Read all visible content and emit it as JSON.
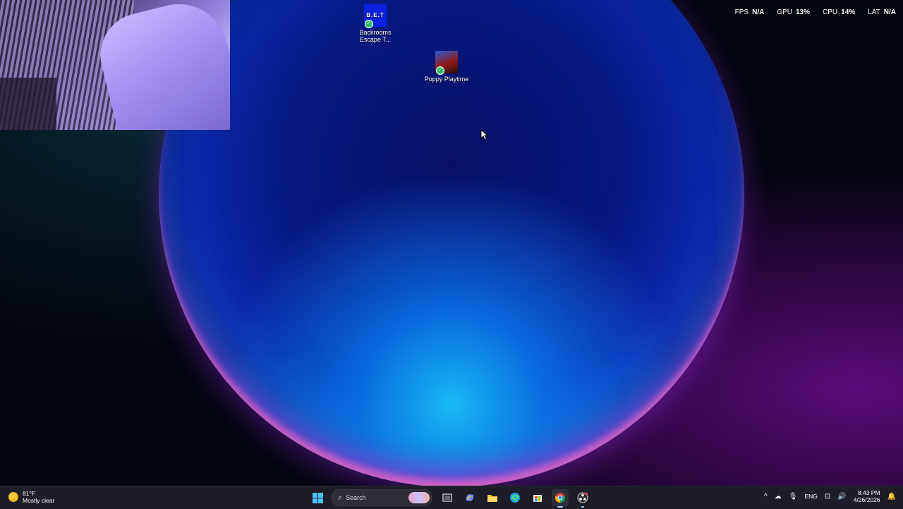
{
  "overlay": {
    "fps_label": "FPS",
    "fps_value": "N/A",
    "gpu_label": "GPU",
    "gpu_value": "13%",
    "cpu_label": "CPU",
    "cpu_value": "14%",
    "lat_label": "LAT",
    "lat_value": "N/A"
  },
  "desktop_icons": [
    {
      "label": "Backrooms Escape T...",
      "tile_text": "B.E.T"
    },
    {
      "label": "Poppy Playtime"
    }
  ],
  "taskbar": {
    "weather": {
      "temp": "81°F",
      "condition": "Mostly clear"
    },
    "search_placeholder": "Search",
    "tray": {
      "language": "ENG",
      "time": "8:43 PM",
      "date": "4/26/2026"
    }
  },
  "colors": {
    "accent": "#4cc2ff",
    "taskbar_bg": "#1c1d26"
  }
}
